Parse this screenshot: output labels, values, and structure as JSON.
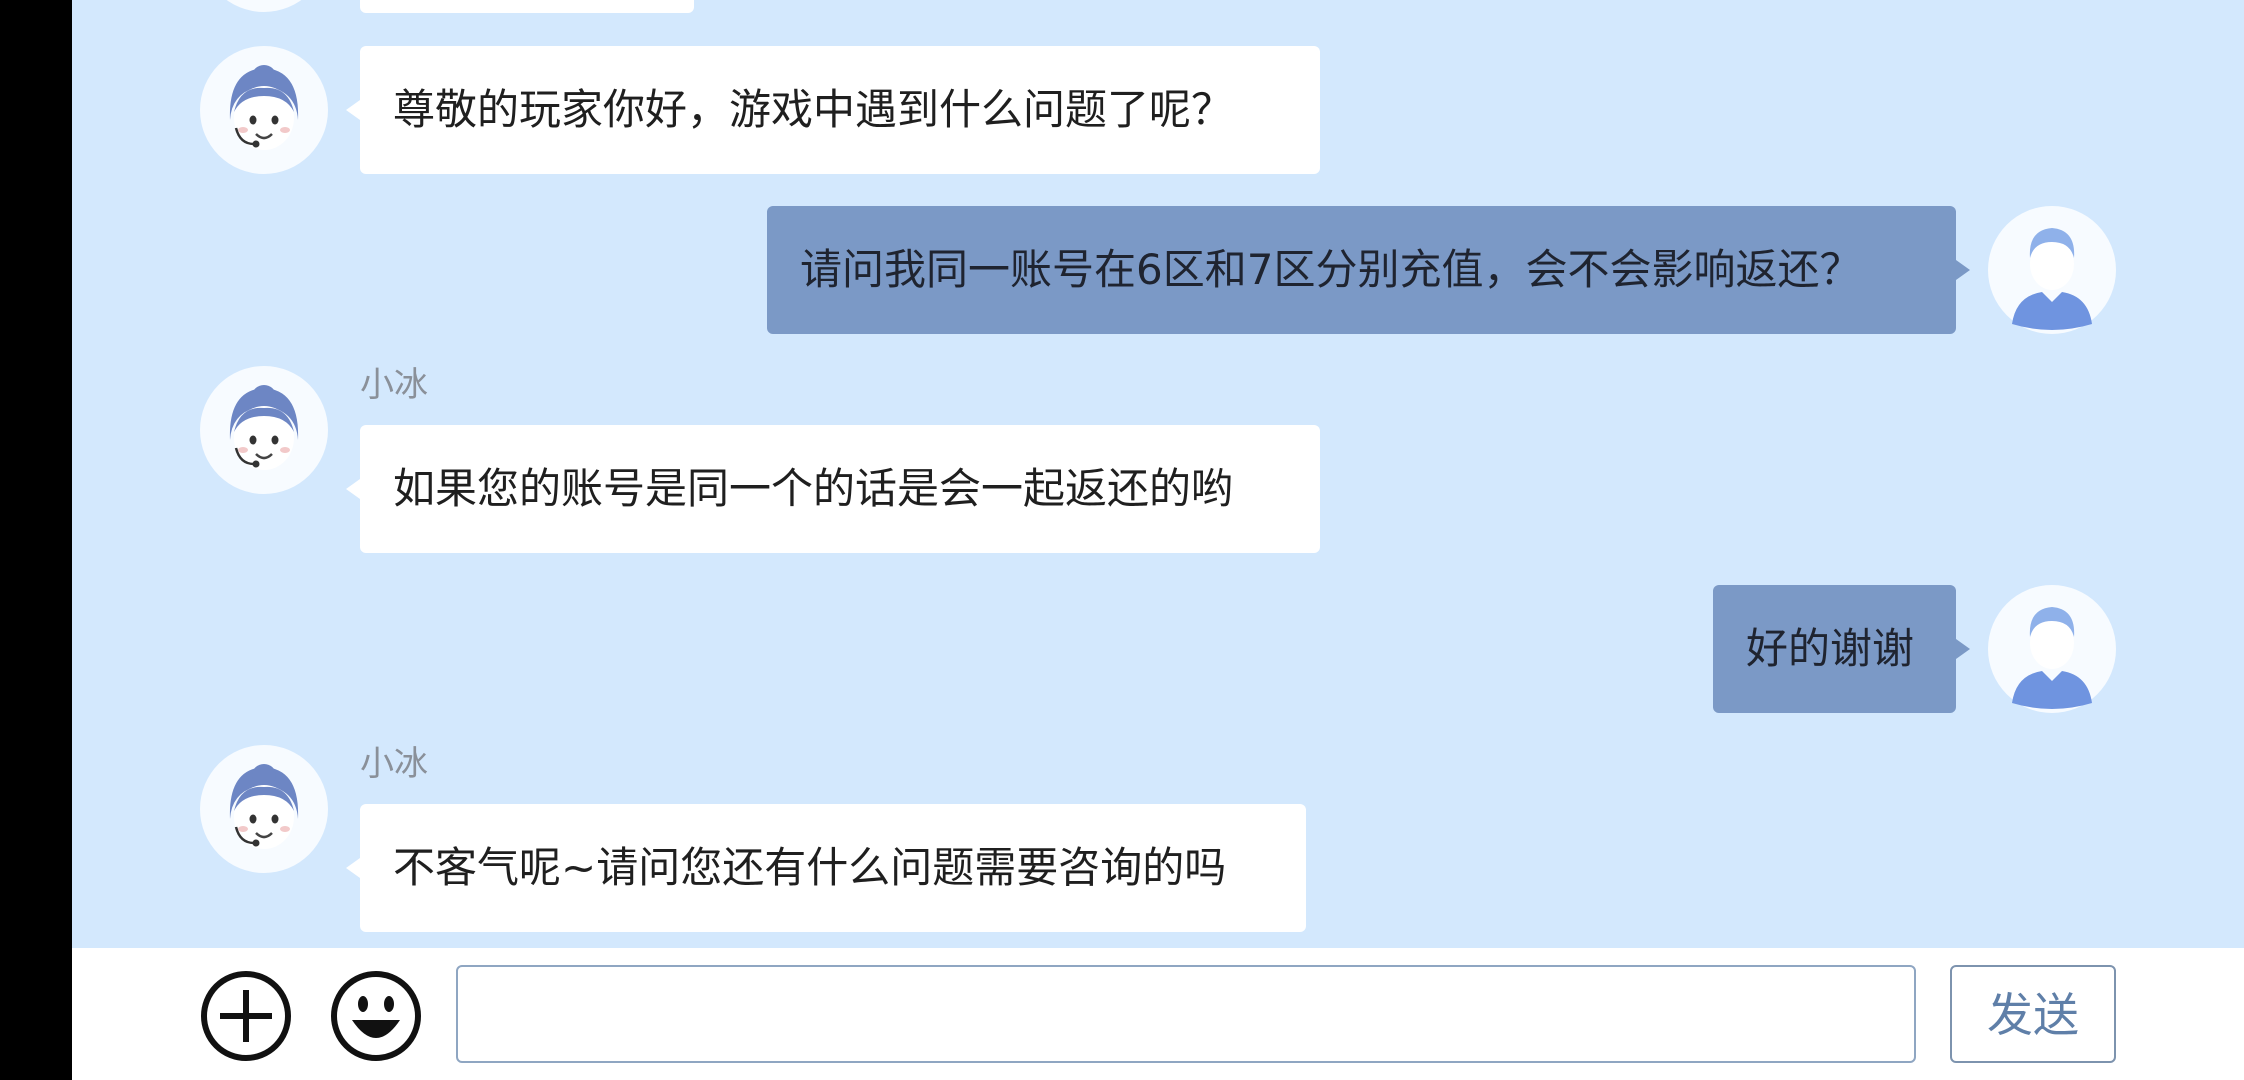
{
  "colors": {
    "chat_background": "#d3e8fd",
    "agent_bubble": "#ffffff",
    "user_bubble": "#7b99c6",
    "send_text": "#5f7fa8"
  },
  "messages": [
    {
      "sender": "agent",
      "name": "",
      "text": "尊敬的玩家你好，游戏中遇到什么问题了呢？",
      "avatar": "agent-avatar-icon"
    },
    {
      "sender": "user",
      "text": "请问我同一账号在6区和7区分别充值，会不会影响返还？",
      "avatar": "user-avatar-icon"
    },
    {
      "sender": "agent",
      "name": "小冰",
      "text": "如果您的账号是同一个的话是会一起返还的哟",
      "avatar": "agent-avatar-icon"
    },
    {
      "sender": "user",
      "text": "好的谢谢",
      "avatar": "user-avatar-icon"
    },
    {
      "sender": "agent",
      "name": "小冰",
      "text": "不客气呢~请问您还有什么问题需要咨询的吗",
      "avatar": "agent-avatar-icon"
    }
  ],
  "input_bar": {
    "add_icon": "plus-circle-icon",
    "emoji_icon": "smiley-icon",
    "input_value": "",
    "input_placeholder": "",
    "send_label": "发送"
  }
}
